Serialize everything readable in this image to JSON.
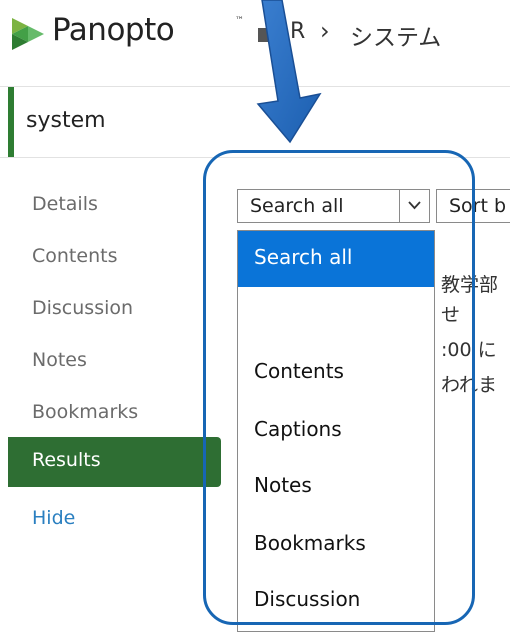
{
  "header": {
    "brand": "Panopto",
    "brand_mark": "™",
    "breadcrumb_root": "R",
    "breadcrumb_separator": "›",
    "breadcrumb_current": "システム"
  },
  "title_bar": {
    "title": "system"
  },
  "sidebar": {
    "items": [
      {
        "label": "Details"
      },
      {
        "label": "Contents"
      },
      {
        "label": "Discussion"
      },
      {
        "label": "Notes"
      },
      {
        "label": "Bookmarks"
      },
      {
        "label": "Results",
        "active": true
      }
    ],
    "hide_label": "Hide"
  },
  "search": {
    "selected": "Search all",
    "sort_label": "Sort b",
    "options": [
      {
        "label": "Search all",
        "selected": true
      },
      {
        "label": ""
      },
      {
        "label": "Contents"
      },
      {
        "label": "Captions"
      },
      {
        "label": "Notes"
      },
      {
        "label": "Bookmarks"
      },
      {
        "label": "Discussion"
      }
    ]
  },
  "background_text": [
    "教学部",
    "せ",
    ":00 に",
    "われま"
  ],
  "colors": {
    "accent_green": "#2e6e33",
    "link_blue": "#2a7fc0",
    "selection_blue": "#0a74d8",
    "annotation_blue": "#1766b4"
  }
}
